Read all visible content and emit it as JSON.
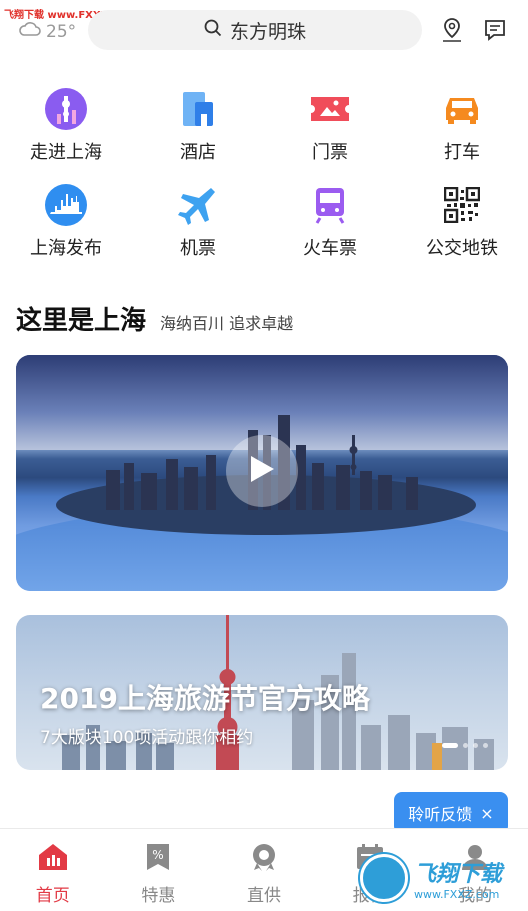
{
  "watermark_top": "飞翔下载 www.FXXZ.com",
  "weather": {
    "temp": "25°",
    "icon": "cloudy-icon"
  },
  "search": {
    "text": "东方明珠"
  },
  "grid": [
    {
      "label": "走进上海",
      "icon": "tower-icon",
      "color": "#8a5cf0"
    },
    {
      "label": "酒店",
      "icon": "building-icon",
      "color": "#3d8ef0"
    },
    {
      "label": "门票",
      "icon": "ticket-icon",
      "color": "#f04d5a"
    },
    {
      "label": "打车",
      "icon": "car-icon",
      "color": "#f58a1f"
    },
    {
      "label": "上海发布",
      "icon": "skyline-icon",
      "color": "#2f8ef0"
    },
    {
      "label": "机票",
      "icon": "plane-icon",
      "color": "#3ea2f0"
    },
    {
      "label": "火车票",
      "icon": "train-icon",
      "color": "#9b5cf0"
    },
    {
      "label": "公交地铁",
      "icon": "qr-code-icon",
      "color": "#333333"
    }
  ],
  "section": {
    "title": "这里是上海",
    "subtitle": "海纳百川 追求卓越"
  },
  "banner": {
    "title": "2019上海旅游节官方攻略",
    "subtitle": "7大版块100项活动跟你相约"
  },
  "feedback": {
    "label": "聆听反馈",
    "close": "×"
  },
  "tabs": [
    {
      "label": "首页",
      "icon": "home-icon",
      "active": true
    },
    {
      "label": "特惠",
      "icon": "discount-icon",
      "active": false
    },
    {
      "label": "直供",
      "icon": "badge-icon",
      "active": false
    },
    {
      "label": "报价",
      "icon": "calendar-icon",
      "active": false
    },
    {
      "label": "我的",
      "icon": "user-icon",
      "active": false
    }
  ],
  "watermark_br": {
    "main": "飞翔下载",
    "url": "www.FXXZ.com"
  },
  "colors": {
    "accent": "#e23a45",
    "feedback": "#3a8ff0"
  }
}
